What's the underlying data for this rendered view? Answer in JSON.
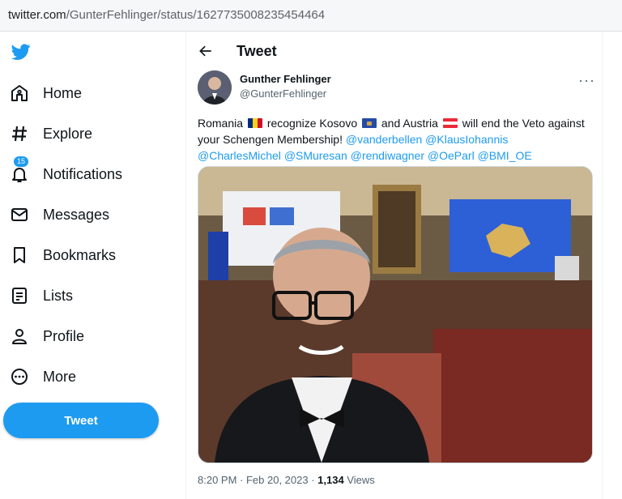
{
  "browser": {
    "url_host": "twitter.com",
    "url_path": "/GunterFehlinger/status/1627735008235454464"
  },
  "sidebar": {
    "items": [
      {
        "label": "Home",
        "icon": "home-icon"
      },
      {
        "label": "Explore",
        "icon": "hashtag-icon"
      },
      {
        "label": "Notifications",
        "icon": "bell-icon",
        "badge": "15"
      },
      {
        "label": "Messages",
        "icon": "envelope-icon"
      },
      {
        "label": "Bookmarks",
        "icon": "bookmark-icon"
      },
      {
        "label": "Lists",
        "icon": "list-icon"
      },
      {
        "label": "Profile",
        "icon": "person-icon"
      },
      {
        "label": "More",
        "icon": "more-circle-icon"
      }
    ],
    "tweet_button": "Tweet"
  },
  "header": {
    "title": "Tweet"
  },
  "tweet": {
    "author_name": "Gunther Fehlinger",
    "author_handle": "@GunterFehlinger",
    "text_1": "Romania",
    "text_2": "recognize Kosovo",
    "text_3": "and Austria",
    "text_4": "will end the Veto against your Schengen Membership!",
    "mentions": [
      "@vanderbellen",
      "@KlausIohannis",
      "@CharlesMichel",
      "@SMuresan",
      "@rendiwagner",
      "@OeParl",
      "@BMI_OE"
    ],
    "time": "8:20 PM · Feb 20, 2023 ·",
    "views_count": "1,134",
    "views_label": "Views"
  },
  "colors": {
    "accent": "#1d9bf0",
    "text": "#0f1419",
    "muted": "#536471"
  }
}
